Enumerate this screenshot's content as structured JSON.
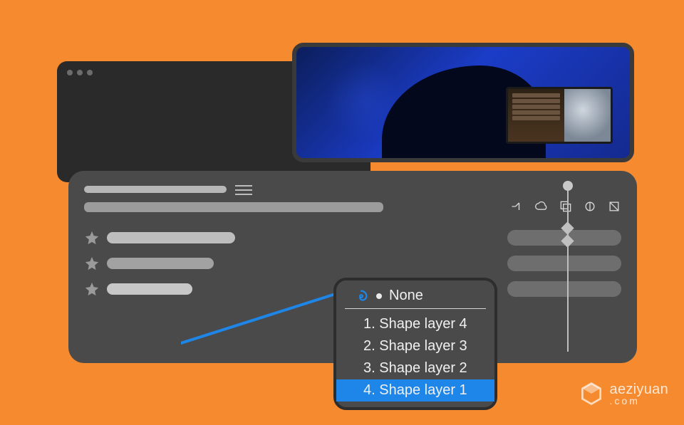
{
  "dropdown": {
    "none_label": "None",
    "items": [
      {
        "label": "1. Shape layer 4",
        "selected": false
      },
      {
        "label": "2. Shape layer 3",
        "selected": false
      },
      {
        "label": "3. Shape layer 2",
        "selected": false
      },
      {
        "label": "4. Shape layer 1",
        "selected": true
      }
    ]
  },
  "watermark": {
    "brand": "aeziyuan",
    "tld": ".com"
  },
  "colors": {
    "background": "#f58a2e",
    "panel": "#4a4a4a",
    "accent": "#1d86e8",
    "pickwhip": "#1d86e8"
  },
  "toolbar_icons": [
    "snap-icon",
    "cloud-icon",
    "layers-icon",
    "effects-icon",
    "box-icon"
  ],
  "layer_rows": 3
}
